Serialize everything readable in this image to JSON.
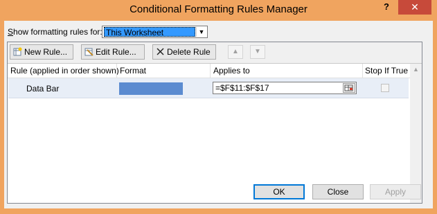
{
  "window": {
    "title": "Conditional Formatting Rules Manager",
    "help_label": "?",
    "close_label": "✕"
  },
  "show_rules": {
    "label": "Show formatting rules for:",
    "selected": "This Worksheet"
  },
  "toolbar": {
    "new_rule": "New Rule...",
    "edit_rule": "Edit Rule...",
    "delete_rule": "Delete Rule",
    "move_up": "▲",
    "move_down": "▼"
  },
  "columns": {
    "rule": "Rule (applied in order shown)",
    "format": "Format",
    "applies_to": "Applies to",
    "stop_if_true": "Stop If True"
  },
  "rules": [
    {
      "name": "Data Bar",
      "format_color": "#5b8bd0",
      "applies_to": "=$F$11:$F$17",
      "stop_if_true": false
    }
  ],
  "buttons": {
    "ok": "OK",
    "close": "Close",
    "apply": "Apply"
  },
  "colors": {
    "title_bar": "#f0a45f",
    "close_button": "#c74a3a",
    "selection": "#3399ff",
    "row_highlight": "#e8eef7"
  }
}
